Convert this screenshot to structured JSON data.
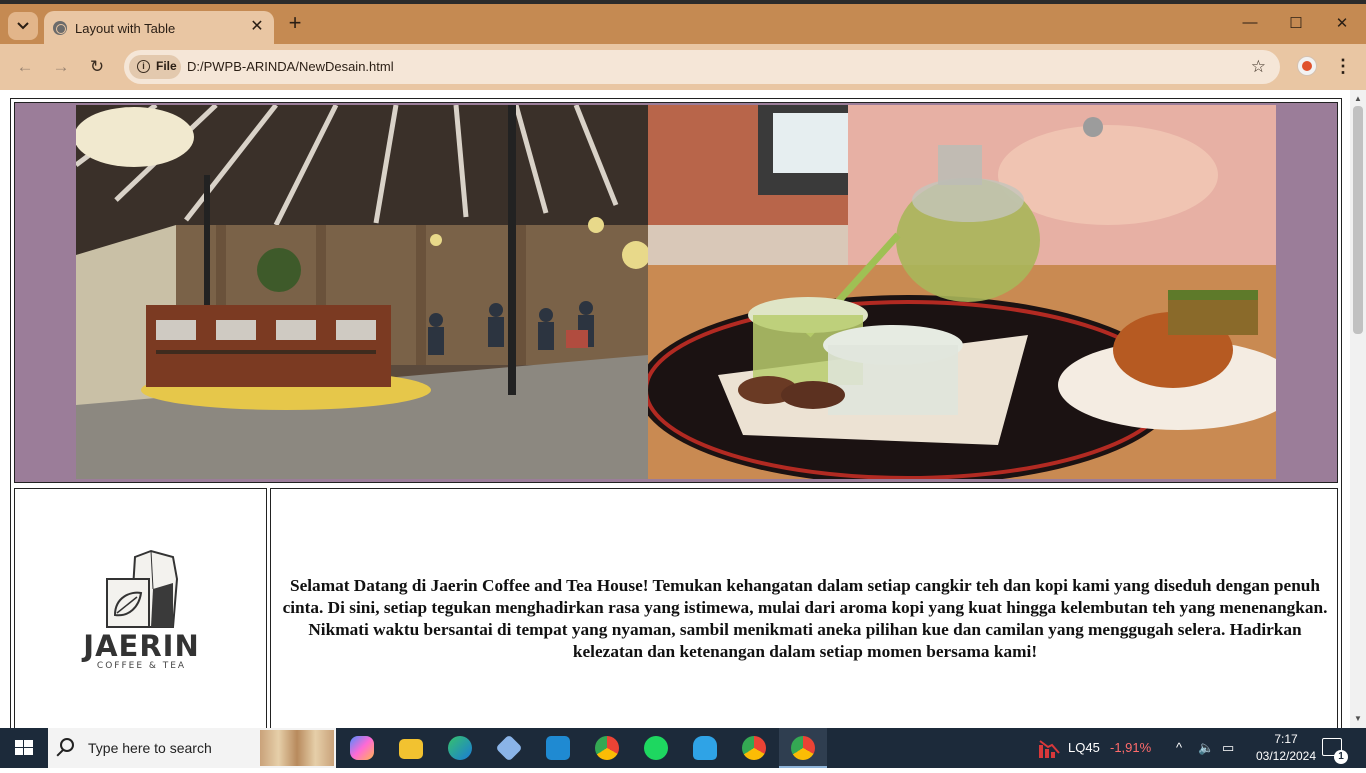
{
  "browser": {
    "tab_title": "Layout with Table",
    "new_tab_label": "+",
    "close_tab_label": "✕",
    "site_chip_label": "File",
    "url": "D:/PWPB-ARINDA/NewDesain.html",
    "window_controls": {
      "minimize": "—",
      "maximize": "☐",
      "close": "✕"
    }
  },
  "page": {
    "logo_name": "JAERIN",
    "logo_tagline": "COFFEE & TEA",
    "welcome_text": "Selamat Datang di Jaerin Coffee and Tea House! Temukan kehangatan dalam setiap cangkir teh dan kopi kami yang diseduh dengan penuh cinta. Di sini, setiap tegukan menghadirkan rasa yang istimewa, mulai dari aroma kopi yang kuat hingga kelembutan teh yang menenangkan. Nikmati waktu bersantai di tempat yang nyaman, sambil menikmati aneka pilihan kue dan camilan yang menggugah selera. Hadirkan kelezatan dan ketenangan dalam setiap momen bersama kami!",
    "hero_background": "#9b7d99"
  },
  "taskbar": {
    "search_placeholder": "Type here to search",
    "apps": [
      "copilot-icon",
      "file-explorer-icon",
      "edge-icon",
      "virtualbox-icon",
      "vscode-icon",
      "chrome-icon",
      "spotify-icon",
      "app-icon",
      "chrome-profile-icon",
      "chrome-active-icon"
    ],
    "stock_name": "LQ45",
    "stock_change": "-1,91%",
    "time": "7:17",
    "date": "03/12/2024",
    "notification_count": "1"
  }
}
